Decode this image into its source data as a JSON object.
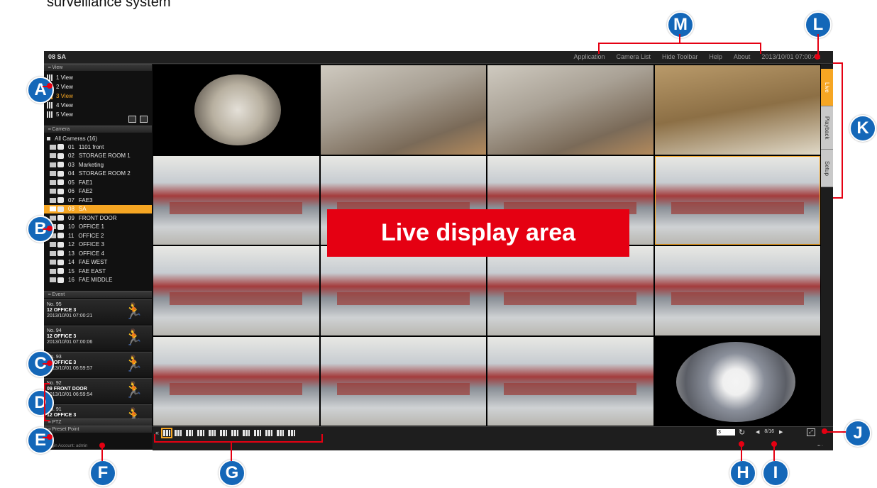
{
  "caption": "surveillance system",
  "window": {
    "title": "08 SA",
    "menu": [
      "Application",
      "Camera List",
      "Hide Toolbar",
      "Help",
      "About"
    ],
    "clock": "2013/10/01 07:00:41"
  },
  "sidebar": {
    "view_header": "View",
    "views": [
      "1 View",
      "2 View",
      "3 View",
      "4 View",
      "5 View"
    ],
    "selected_view": "3 View",
    "camera_header": "Camera",
    "all_cameras": "All Cameras (16)",
    "cameras": [
      {
        "num": "01",
        "name": "1101 front"
      },
      {
        "num": "02",
        "name": "STORAGE ROOM 1"
      },
      {
        "num": "03",
        "name": "Marketing"
      },
      {
        "num": "04",
        "name": "STORAGE ROOM 2"
      },
      {
        "num": "05",
        "name": "FAE1"
      },
      {
        "num": "06",
        "name": "FAE2"
      },
      {
        "num": "07",
        "name": "FAE3"
      },
      {
        "num": "08",
        "name": "SA"
      },
      {
        "num": "09",
        "name": "FRONT DOOR"
      },
      {
        "num": "10",
        "name": "OFFICE 1"
      },
      {
        "num": "11",
        "name": "OFFICE 2"
      },
      {
        "num": "12",
        "name": "OFFICE 3"
      },
      {
        "num": "13",
        "name": "OFFICE 4"
      },
      {
        "num": "14",
        "name": "FAE WEST"
      },
      {
        "num": "15",
        "name": "FAE EAST"
      },
      {
        "num": "16",
        "name": "FAE MIDDLE"
      }
    ],
    "selected_camera": "08",
    "event_header": "Event",
    "events": [
      {
        "no": "No. 95",
        "camera": "12 OFFICE 3",
        "time": "2013/10/01 07:00:21"
      },
      {
        "no": "No. 94",
        "camera": "12 OFFICE 3",
        "time": "2013/10/01 07:00:06"
      },
      {
        "no": "No. 93",
        "camera": "12 OFFICE 3",
        "time": "2013/10/01 06:59:57"
      },
      {
        "no": "No. 92",
        "camera": "09 FRONT DOOR",
        "time": "2013/10/01 06:59:54"
      },
      {
        "no": "No. 91",
        "camera": "12 OFFICE 3",
        "time": ""
      }
    ],
    "ptz_header": "PTZ",
    "preset_header": "Preset Point",
    "login": "Login Account: admin"
  },
  "live": {
    "label": "Live display area"
  },
  "tabs": [
    "Live",
    "Playback",
    "Setup"
  ],
  "toolbar": {
    "dwell_value": "3",
    "page": "8/16"
  },
  "callouts": [
    "A",
    "B",
    "C",
    "D",
    "E",
    "F",
    "G",
    "H",
    "I",
    "J",
    "K",
    "L",
    "M"
  ],
  "colors": {
    "accent": "#f6a623",
    "callout": "#1467b8",
    "marker": "#e50012"
  }
}
